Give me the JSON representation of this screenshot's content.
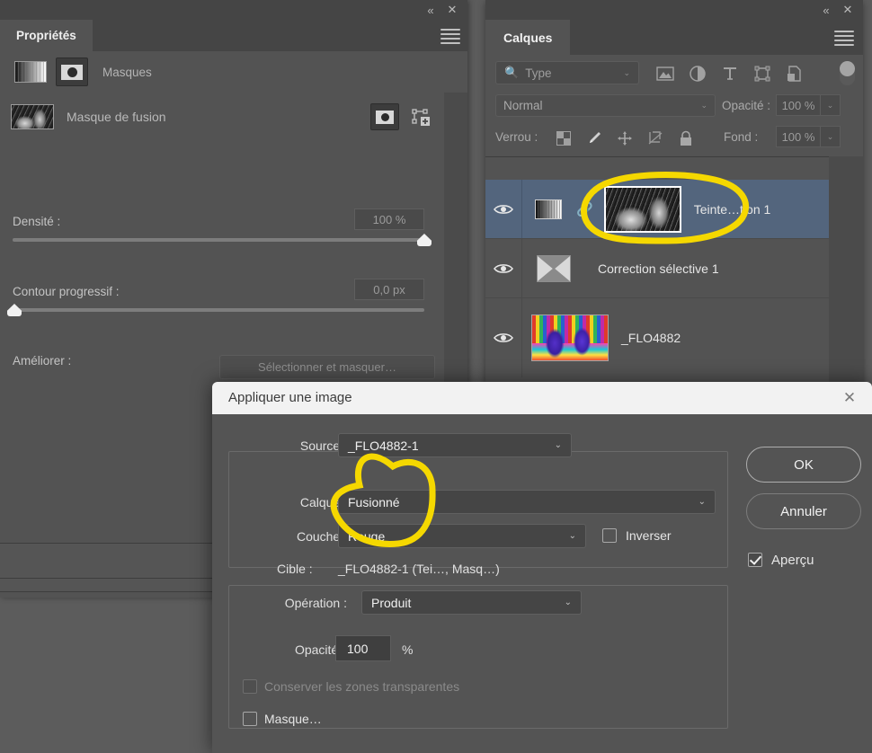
{
  "properties_panel": {
    "tab_label": "Propriétés",
    "collapse_icon": "«",
    "close_icon": "✕",
    "menu_icon": "hamburger-icon",
    "mask_mode": {
      "gradient_mask_icon": "gradient-mask-icon",
      "pixel_mask_icon": "pixel-mask-icon",
      "label": "Masques"
    },
    "mask_item": {
      "thumbnail": "layer-mask-thumbnail",
      "title": "Masque de fusion",
      "select_mask_icon": "pixel-mask-icon",
      "add_mask_icon": "add-vector-mask-icon"
    },
    "density": {
      "label": "Densité :",
      "value": "100 %",
      "slider_pct": 100
    },
    "feather": {
      "label": "Contour progressif :",
      "value": "0,0 px",
      "slider_pct": 0
    },
    "improve": {
      "label": "Améliorer :",
      "button_label": "Sélectionner et masquer…"
    }
  },
  "layers_panel": {
    "tab_label": "Calques",
    "collapse_icon": "«",
    "close_icon": "✕",
    "menu_icon": "hamburger-icon",
    "filter": {
      "search_icon": "search-icon",
      "type_label": "Type",
      "chevron": "⌄",
      "icons": [
        "image-filter-icon",
        "adjustment-filter-icon",
        "type-filter-icon",
        "shape-filter-icon",
        "smart-object-filter-icon"
      ],
      "toggle": "filter-enable-toggle"
    },
    "blend": {
      "mode": "Normal",
      "chevron": "⌄",
      "opacity_label": "Opacité :",
      "opacity_value": "100 %",
      "stepper": "⌄"
    },
    "lock": {
      "label": "Verrou :",
      "icons": [
        "lock-transparency-icon",
        "lock-image-icon",
        "lock-position-icon",
        "lock-artboard-icon",
        "lock-all-icon"
      ],
      "fill_label": "Fond :",
      "fill_value": "100 %",
      "stepper": "⌄"
    },
    "rows": [
      {
        "name": "Teinte…tion 1",
        "visible_icon": "eye-icon",
        "layer_thumb": "gradient-map-thumbnail",
        "link_icon": "link-icon",
        "mask_thumb": "layer-mask-thumbnail",
        "selected": true
      },
      {
        "name": "Correction sélective 1",
        "visible_icon": "eye-icon",
        "layer_thumb": "selective-color-thumbnail",
        "selected": false
      },
      {
        "name": "_FLO4882",
        "visible_icon": "eye-icon",
        "layer_thumb": "photo-thumbnail",
        "selected": false
      }
    ]
  },
  "dialog": {
    "title": "Appliquer une image",
    "close_icon": "✕",
    "source": {
      "label": "Source :",
      "value": "_FLO4882-1",
      "chevron": "⌄"
    },
    "layer": {
      "label": "Calque :",
      "value": "Fusionné",
      "chevron": "⌄"
    },
    "channel": {
      "label": "Couche :",
      "value": "Rouge",
      "chevron": "⌄"
    },
    "invert": {
      "label": "Inverser",
      "checked": false
    },
    "target": {
      "label": "Cible :",
      "value": "_FLO4882-1 (Tei…, Masq…)"
    },
    "operation": {
      "label": "Opération :",
      "value": "Produit",
      "chevron": "⌄"
    },
    "opacity": {
      "label": "Opacité :",
      "value": "100",
      "unit": "%"
    },
    "preserve_transparency": {
      "label": "Conserver les zones transparentes",
      "checked": false,
      "disabled": true
    },
    "mask": {
      "label": "Masque…",
      "checked": false
    },
    "ok_button": "OK",
    "cancel_button": "Annuler",
    "preview": {
      "label": "Aperçu",
      "checked": true
    }
  },
  "annotations": {
    "marker_color": "#f5d800",
    "ellipse_layer_thumb": "hand-drawn-ellipse-around-layer-mask-thumbnail",
    "ellipse_layer_channel": "hand-drawn-ellipse-around-layer-and-channel-selects"
  },
  "colors": {
    "panel_bg": "#535353",
    "titlebar_bg": "#454545",
    "selected_layer": "#53657d",
    "dialog_bg": "#545454",
    "dialog_titlebar": "#f2f2f2",
    "marker_yellow": "#f5d800",
    "desktop_bg": "#5c5c5c"
  }
}
